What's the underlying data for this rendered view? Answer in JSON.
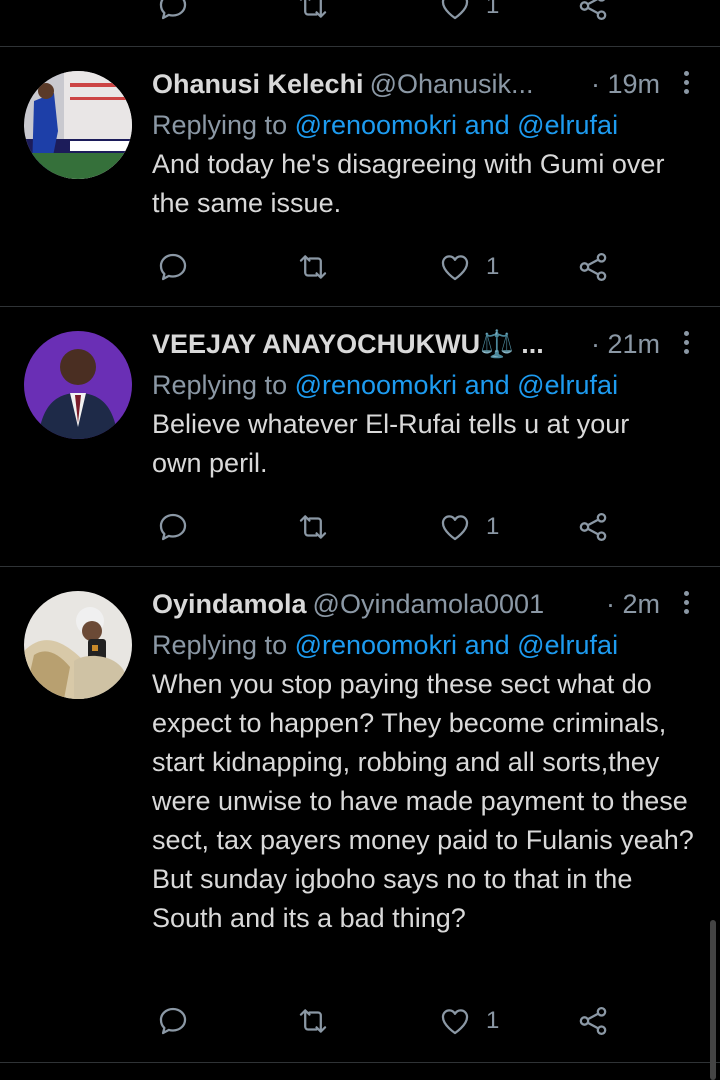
{
  "colors": {
    "background": "#000000",
    "accent": "#1d9bf0",
    "muted": "#8b98a5",
    "divider": "#2f3336"
  },
  "icons": {
    "reply": "reply-bubble-icon",
    "retweet": "retweet-icon",
    "like": "heart-icon",
    "share": "share-icon",
    "more": "more-vertical-icon"
  },
  "top_actions": {
    "like_count": "1"
  },
  "tweets": [
    {
      "name": "Ohanusi Kelechi",
      "handle": "@Ohanusik...",
      "time": "· 19m",
      "replying_prefix": "Replying to ",
      "mention1": "@renoomokri",
      "and": " and ",
      "mention2": "@elrufai",
      "text": "And today he's disagreeing with Gumi over the same issue.",
      "like_count": "1"
    },
    {
      "name": "VEEJAY ANAYOCHUKWU⚖️ ...",
      "handle": "",
      "time": "· 21m",
      "replying_prefix": "Replying to ",
      "mention1": "@renoomokri",
      "and": " and ",
      "mention2": "@elrufai",
      "text": "Believe whatever El-Rufai tells u at your own peril.",
      "like_count": "1"
    },
    {
      "name": "Oyindamola",
      "handle": "@Oyindamola0001",
      "time": "· 2m",
      "replying_prefix": "Replying to ",
      "mention1": "@renoomokri",
      "and": " and ",
      "mention2": "@elrufai",
      "text": "When you stop paying these sect what do expect to happen? They become criminals, start kidnapping, robbing and all sorts,they were unwise to have made payment to these sect, tax payers money paid to Fulanis yeah? But sunday igboho says no to that in the South and its a bad thing?",
      "like_count": "1"
    }
  ]
}
